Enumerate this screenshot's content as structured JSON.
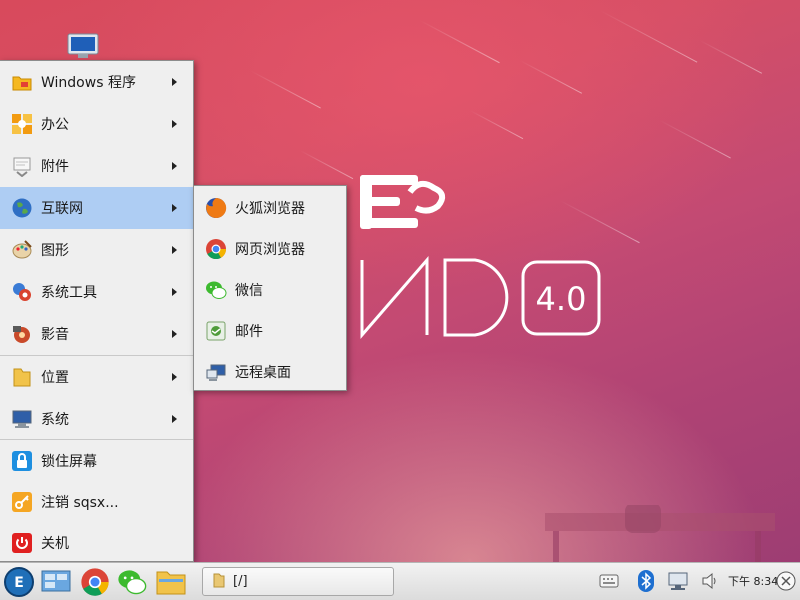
{
  "menu": {
    "items": [
      {
        "label": "Windows 程序",
        "icon": "folder-star-icon"
      },
      {
        "label": "办公",
        "icon": "office-icon"
      },
      {
        "label": "附件",
        "icon": "accessories-icon"
      },
      {
        "label": "互联网",
        "icon": "globe-icon"
      },
      {
        "label": "图形",
        "icon": "palette-icon"
      },
      {
        "label": "系统工具",
        "icon": "system-tools-icon"
      },
      {
        "label": "影音",
        "icon": "multimedia-icon"
      },
      {
        "label": "位置",
        "icon": "folder-icon"
      },
      {
        "label": "系统",
        "icon": "computer-icon"
      },
      {
        "label": "锁住屏幕",
        "icon": "lock-icon"
      },
      {
        "label": "注销 sqsx...",
        "icon": "key-icon"
      },
      {
        "label": "关机",
        "icon": "power-icon"
      }
    ],
    "active_item": "互联网"
  },
  "submenu": {
    "items": [
      {
        "label": "火狐浏览器",
        "icon": "firefox-icon"
      },
      {
        "label": "网页浏览器",
        "icon": "chrome-icon"
      },
      {
        "label": "微信",
        "icon": "wechat-icon"
      },
      {
        "label": "邮件",
        "icon": "mail-icon"
      },
      {
        "label": "远程桌面",
        "icon": "remote-desktop-icon"
      }
    ]
  },
  "taskbar": {
    "task_label": "[/]",
    "clock": "下午 8:34"
  },
  "wallpaper": {
    "version": "4.0"
  },
  "colors": {
    "highlight": "#aecdf3",
    "menu_bg": "#efefef",
    "wallpaper_top": "#d84a5c",
    "wallpaper_bottom": "#9d3d73"
  }
}
